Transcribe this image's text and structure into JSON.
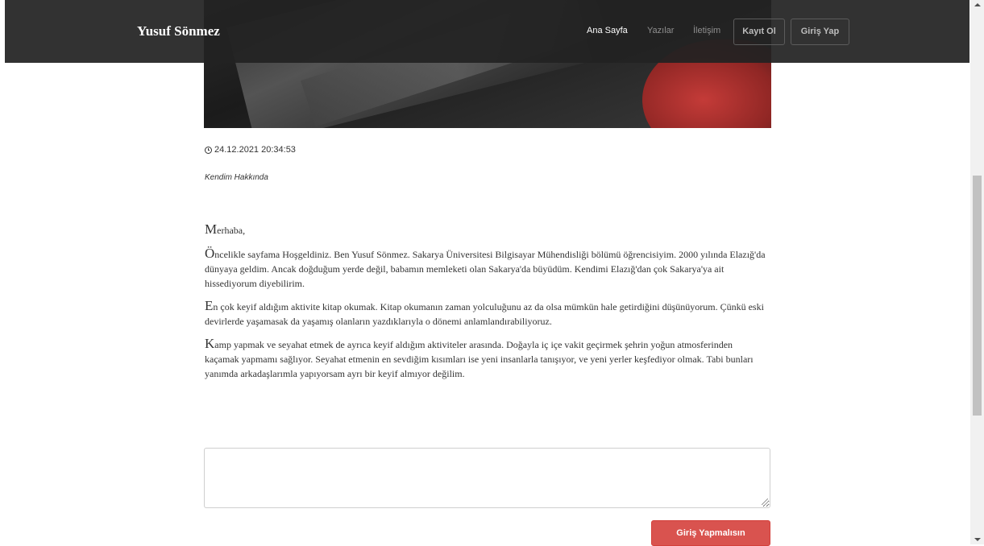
{
  "navbar": {
    "brand": "Yusuf Sönmez",
    "links": [
      "Ana Sayfa",
      "Yazılar",
      "İletişim"
    ],
    "buttons": [
      "Kayıt Ol",
      "Giriş Yap"
    ]
  },
  "post": {
    "timestamp": "24.12.2021 20:34:53",
    "category": "Kendim Hakkında",
    "paragraphs": [
      {
        "cap": "M",
        "rest": "erhaba,"
      },
      {
        "cap": "Ö",
        "rest": "ncelikle sayfama Hoşgeldiniz. Ben Yusuf Sönmez. Sakarya Üniversitesi Bilgisayar Mühendisliği bölümü öğrencisiyim. 2000 yılında Elazığ'da dünyaya geldim. Ancak doğduğum yerde değil, babamın memleketi olan Sakarya'da büyüdüm. Kendimi Elazığ'dan çok Sakarya'ya ait hissediyorum diyebilirim."
      },
      {
        "cap": "E",
        "rest": "n çok keyif aldığım aktivite kitap okumak. Kitap okumanın zaman yolculuğunu az da olsa mümkün hale getirdiğini düşünüyorum. Çünkü eski devirlerde yaşamasak da yaşamış olanların yazdıklarıyla o dönemi anlamlandırabiliyoruz."
      },
      {
        "cap": "K",
        "rest": "amp yapmak ve seyahat etmek de ayrıca keyif aldığım aktiviteler arasında. Doğayla iç içe vakit geçirmek şehrin yoğun atmosferinden kaçamak yapmamı sağlıyor. Seyahat etmenin en sevdiğim kısımları ise yeni insanlarla tanışıyor, ve yeni yerler keşfediyor olmak. Tabi bunları yanımda arkadaşlarımla yapıyorsam ayrı bir keyif almıyor değilim."
      }
    ]
  },
  "comment": {
    "value": "",
    "submit_label": "Giriş Yapmalısın"
  },
  "icons": {
    "timestamp_icon": "clock-icon"
  },
  "colors": {
    "navbar_bg": "#222222",
    "submit_bg": "#d9534f"
  }
}
